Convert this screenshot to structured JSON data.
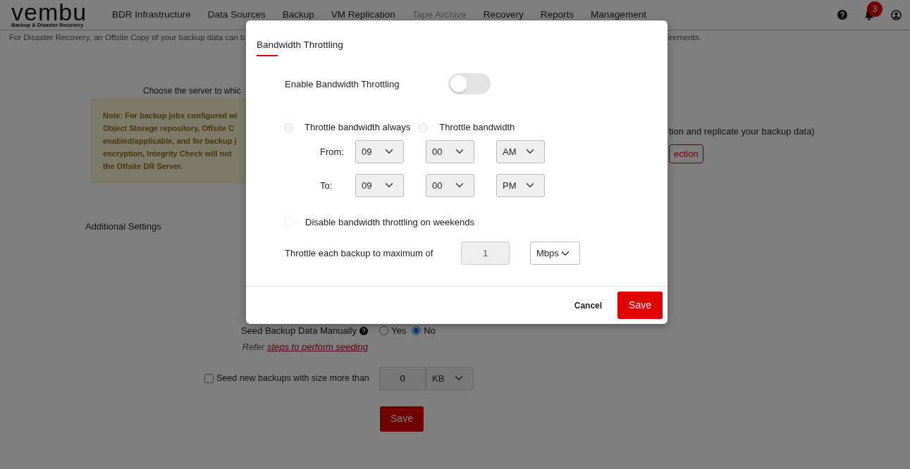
{
  "navbar": {
    "logo": "vembu",
    "logo_tagline": "Backup & Disaster Recovery",
    "items": [
      {
        "label": "BDR Infrastructure",
        "disabled": false
      },
      {
        "label": "Data Sources",
        "disabled": false
      },
      {
        "label": "Backup",
        "disabled": false
      },
      {
        "label": "VM Replication",
        "disabled": false
      },
      {
        "label": "Tape Archive",
        "disabled": true
      },
      {
        "label": "Recovery",
        "disabled": false
      },
      {
        "label": "Reports",
        "disabled": false
      },
      {
        "label": "Management",
        "disabled": false
      }
    ],
    "notification_count": "3"
  },
  "page": {
    "info_left": "For Disaster Recovery, an Offsite Copy of your backup data can b",
    "info_right": "irements.",
    "choose_server": "Choose the server to whic",
    "note_lines": [
      "Note: For backup jobs configured wi",
      "Object Storage repository, Offsite C",
      "enabled/applicable, and for backup j",
      "encryption, Integrity Check will not",
      "the Offsite DR Server."
    ],
    "replicate_text": "tion and replicate your backup data)",
    "connection_button": "ection",
    "additional_settings": "Additional Settings",
    "seed_label": "Seed Backup Data Manually",
    "seed_options": [
      {
        "label": "Yes",
        "selected": false
      },
      {
        "label": "No",
        "selected": true
      }
    ],
    "refer_prefix": "Refer",
    "refer_link": "steps to perform seeding",
    "seed_size": {
      "label": "Seed new backups with size more than",
      "checked": false,
      "value": "0",
      "unit": "KB"
    },
    "save_button": "Save"
  },
  "modal": {
    "title": "Bandwidth Throttling",
    "enable": {
      "label": "Enable Bandwidth Throttling",
      "on": false
    },
    "modes": [
      {
        "label": "Throttle bandwidth always",
        "selected": false,
        "disabled": true
      },
      {
        "label": "Throttle bandwidth",
        "selected": false,
        "disabled": true
      }
    ],
    "schedule": [
      {
        "label": "From:",
        "hour": "09",
        "minute": "00",
        "period": "AM",
        "disabled": true
      },
      {
        "label": "To:",
        "hour": "09",
        "minute": "00",
        "period": "PM",
        "disabled": true
      }
    ],
    "weekends": {
      "label": "Disable bandwidth throttling on weekends",
      "checked": false,
      "disabled": true
    },
    "limit": {
      "label": "Throttle each backup to maximum of",
      "value": "1",
      "disabled": true,
      "unit": "Mbps"
    },
    "cancel": "Cancel",
    "save": "Save"
  }
}
